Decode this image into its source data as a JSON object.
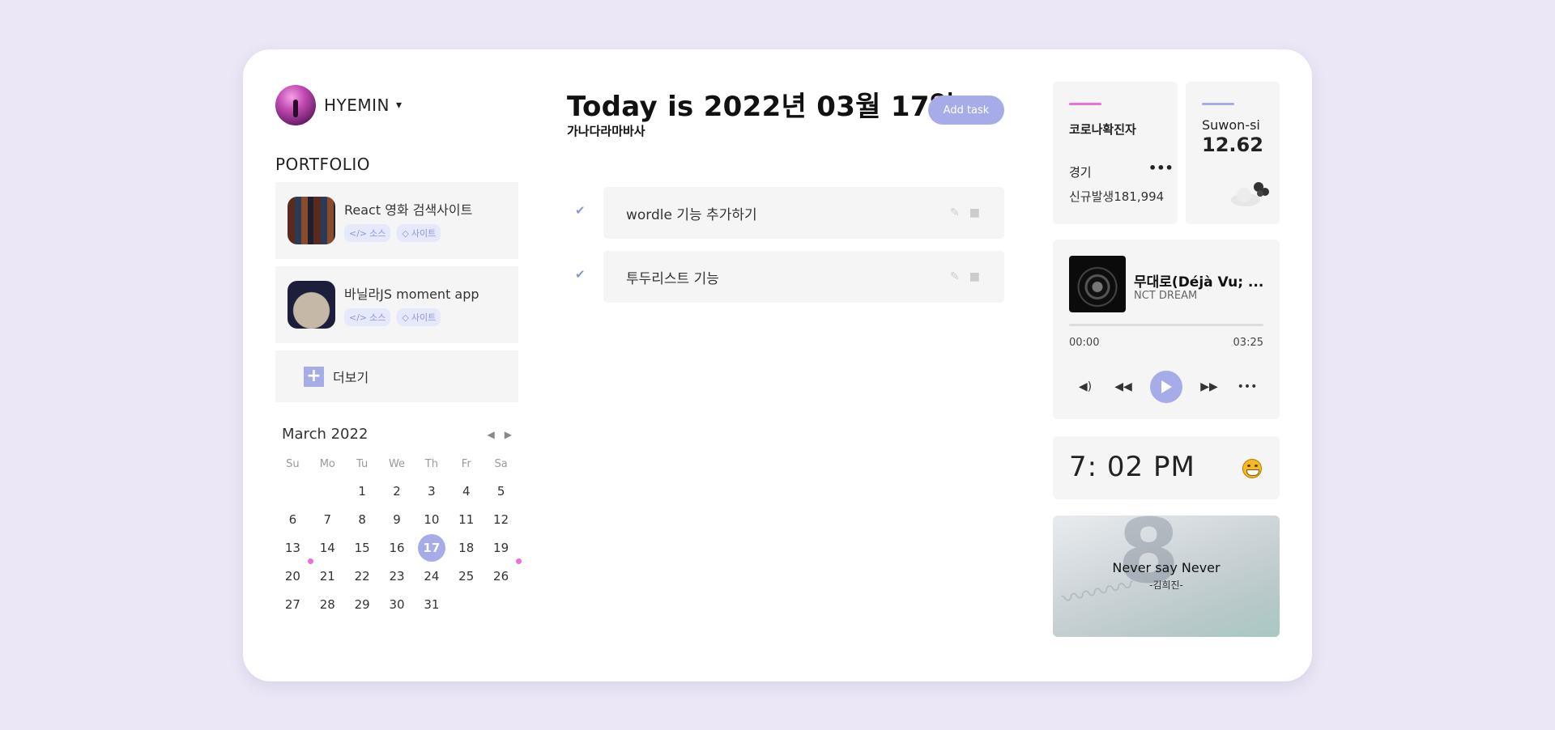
{
  "user": {
    "name": "HYEMIN",
    "caret": "▾"
  },
  "portfolio": {
    "title": "PORTFOLIO",
    "items": [
      {
        "title": "React 영화 검색사이트",
        "source_label": "소스",
        "site_label": "사이트"
      },
      {
        "title": "바닐라JS moment app",
        "source_label": "소스",
        "site_label": "사이트"
      }
    ],
    "more_label": "더보기",
    "more_icon": "+"
  },
  "calendar": {
    "month_label": "March 2022",
    "prev": "◀",
    "next": "▶",
    "weekdays": [
      "Su",
      "Mo",
      "Tu",
      "We",
      "Th",
      "Fr",
      "Sa"
    ],
    "weeks": [
      [
        "",
        "",
        "1",
        "2",
        "3",
        "4",
        "5"
      ],
      [
        "6",
        "7",
        "8",
        "9",
        "10",
        "11",
        "12"
      ],
      [
        "13",
        "14",
        "15",
        "16",
        "17",
        "18",
        "19"
      ],
      [
        "20",
        "21",
        "22",
        "23",
        "24",
        "25",
        "26"
      ],
      [
        "27",
        "28",
        "29",
        "30",
        "31",
        "",
        ""
      ]
    ],
    "today": "17",
    "marked_days": [
      "20",
      "26"
    ]
  },
  "main": {
    "title": "Today is 2022년 03월 17일",
    "subtitle": "가나다라마바사",
    "add_task_label": "Add task",
    "todos": [
      {
        "text": "wordle 기능 추가하기",
        "done": true
      },
      {
        "text": "투두리스트 기능",
        "done": true
      }
    ]
  },
  "covid": {
    "title": "코로나확진자",
    "region": "경기",
    "menu": "•••",
    "new_cases": "신규발생181,994",
    "accent": "#ef6fd8"
  },
  "weather": {
    "city": "Suwon-si",
    "temp": "12.62",
    "icon": "cloud-icon",
    "accent": "#a6ace8"
  },
  "music": {
    "title": "무대로(Déjà Vu; ...",
    "artist": "NCT DREAM",
    "time_start": "00:00",
    "time_end": "03:25",
    "progress": 0
  },
  "clock": {
    "time": "7: 02 PM",
    "icon": "grin-emoji-icon"
  },
  "quote": {
    "text": "Never say Never",
    "author": "-김희진-"
  },
  "colors": {
    "accent": "#a6ace8",
    "background": "#ebe7f7",
    "pink": "#ef6fd8"
  }
}
